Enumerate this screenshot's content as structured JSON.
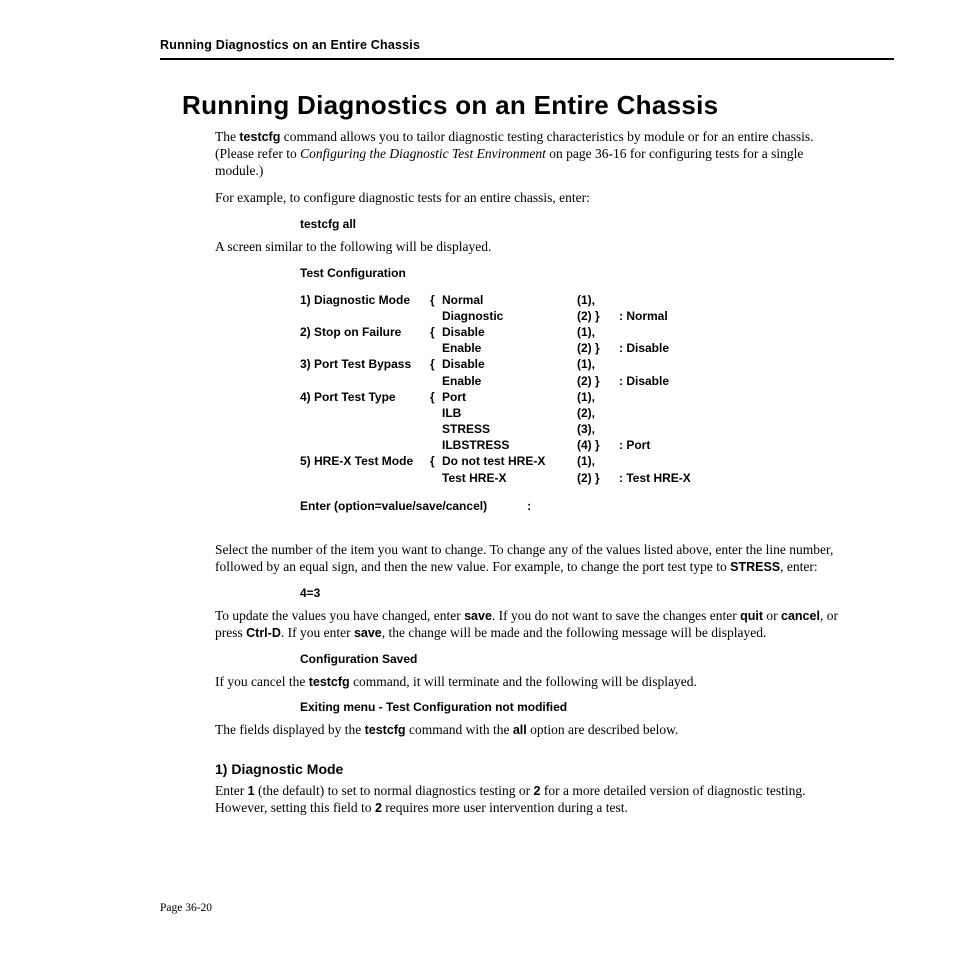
{
  "header": {
    "running_head": "Running Diagnostics on an Entire Chassis"
  },
  "title": "Running Diagnostics on an Entire Chassis",
  "intro": {
    "p1a": "The ",
    "p1_cmd": "testcfg",
    "p1b": " command allows you to tailor diagnostic testing characteristics by module or for an entire chassis. (Please refer to ",
    "p1_em": "Configuring the Diagnostic Test Environment",
    "p1c": " on page 36-16 for configuring tests for a single module.)",
    "p2": "For example, to configure diagnostic tests for an entire chassis, enter:",
    "cmd1": "testcfg all",
    "p3": "A screen similar to the following will be displayed."
  },
  "cfg": {
    "title": "Test Configuration",
    "r1": {
      "label": "1) Diagnostic Mode",
      "opt1": "Normal",
      "n1": "(1),",
      "opt2": "Diagnostic",
      "n2": "(2) }",
      "def": ": Normal"
    },
    "r2": {
      "label": "2) Stop on Failure",
      "opt1": "Disable",
      "n1": "(1),",
      "opt2": "Enable",
      "n2": "(2) }",
      "def": ": Disable"
    },
    "r3": {
      "label": "3) Port Test Bypass",
      "opt1": "Disable",
      "n1": "(1),",
      "opt2": "Enable",
      "n2": "(2) }",
      "def": ": Disable"
    },
    "r4": {
      "label": "4) Port Test Type",
      "opt1": "Port",
      "n1": "(1),",
      "opt2": "ILB",
      "n2": "(2),",
      "opt3": "STRESS",
      "n3": "(3),",
      "opt4": "ILBSTRESS",
      "n4": "(4) }",
      "def": ": Port"
    },
    "r5": {
      "label": "5) HRE-X Test Mode",
      "opt1": "Do not test HRE-X",
      "n1": "(1),",
      "opt2": "Test HRE-X",
      "n2": "(2) }",
      "def": ": Test HRE-X"
    },
    "brace": "{",
    "prompt": "Enter (option=value/save/cancel)",
    "colon": ":"
  },
  "after": {
    "p1a": "Select the number of the item you want to change. To change any of the values listed above, enter the line number, followed by an equal sign, and then the new value. For example, to change the port test type to ",
    "p1_b": "STRESS",
    "p1b": ", enter:",
    "cmd2": "4=3",
    "p2a": "To update the values you have changed, enter ",
    "p2_b1": "save",
    "p2b": ". If you do not want to save the changes enter ",
    "p2_b2": "quit",
    "p2c": " or ",
    "p2_b3": "cancel",
    "p2d": ", or press ",
    "p2_b4": "Ctrl-D",
    "p2e": ". If you enter ",
    "p2_b5": "save",
    "p2f": ", the change will be made and the following message will be displayed.",
    "msg1": "Configuration Saved",
    "p3a": "If you cancel the ",
    "p3_b": "testcfg",
    "p3b": " command, it will terminate and the following will be displayed.",
    "msg2": "Exiting menu - Test Configuration not modified",
    "p4a": "The fields displayed by the ",
    "p4_b1": "testcfg",
    "p4b": " command with the ",
    "p4_b2": "all",
    "p4c": " option are described below."
  },
  "sub": {
    "h": "1) Diagnostic Mode",
    "p_a": "Enter ",
    "p_b1": "1",
    "p_b": " (the default) to set to normal diagnostics testing or ",
    "p_b2": "2",
    "p_c": " for a more detailed version of diagnostic testing. However, setting this field to ",
    "p_b3": "2",
    "p_d": " requires more user intervention during a test."
  },
  "footer": {
    "page": "Page 36-20"
  }
}
